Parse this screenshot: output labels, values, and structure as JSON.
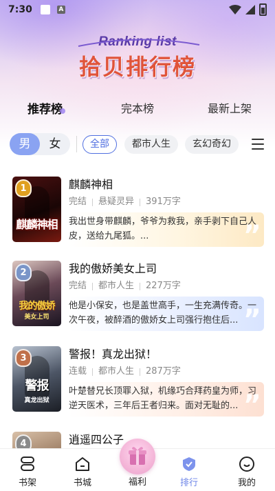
{
  "status_bar": {
    "time": "7:30",
    "notification_letter": "A"
  },
  "banner": {
    "subtitle": "Ranking list",
    "title": "拾贝排行榜"
  },
  "rank_tabs": [
    {
      "label": "推荐榜",
      "active": true
    },
    {
      "label": "完本榜",
      "active": false
    },
    {
      "label": "最新上架",
      "active": false
    }
  ],
  "gender": [
    {
      "label": "男",
      "active": true
    },
    {
      "label": "女",
      "active": false
    }
  ],
  "categories": [
    {
      "label": "全部",
      "active": true
    },
    {
      "label": "都市人生",
      "active": false
    },
    {
      "label": "玄幻奇幻",
      "active": false
    }
  ],
  "books": [
    {
      "rank": "1",
      "title": "麒麟神相",
      "status": "完结",
      "genre": "悬疑灵异",
      "words": "391万字",
      "desc": "我出世身带麒麟，爷爷为救我，亲手剥下自己人皮，送给九尾狐。...",
      "cover_title": "麒麟神相",
      "cover_sub": ""
    },
    {
      "rank": "2",
      "title": "我的傲娇美女上司",
      "status": "完结",
      "genre": "都市人生",
      "words": "227万字",
      "desc": "他是小保安，也是盖世高手，一生充满传奇。一次午夜，被醉酒的傲娇女上司强行抱住后...",
      "cover_title": "我的傲娇",
      "cover_sub": "美女上司"
    },
    {
      "rank": "3",
      "title": "警报！真龙出狱！",
      "status": "连载",
      "genre": "都市人生",
      "words": "287万字",
      "desc": "叶楚替兄长顶罪入狱，机缘巧合拜药皇为师，习逆天医术，三年后王者归来。面对无耻的...",
      "cover_title": "警报",
      "cover_sub": "真龙出狱"
    },
    {
      "rank": "4",
      "title": "逍遥四公子"
    }
  ],
  "bottom_nav": [
    {
      "label": "书架",
      "icon": "bookshelf-icon",
      "active": false
    },
    {
      "label": "书城",
      "icon": "bookstore-icon",
      "active": false
    },
    {
      "label": "福利",
      "icon": "gift-icon",
      "active": false
    },
    {
      "label": "排行",
      "icon": "ranking-icon",
      "active": true
    },
    {
      "label": "我的",
      "icon": "profile-icon",
      "active": false
    }
  ],
  "colors": {
    "accent": "#6f86e8",
    "banner_title": "#e0543a",
    "banner_subtitle": "#5a3ba8"
  }
}
